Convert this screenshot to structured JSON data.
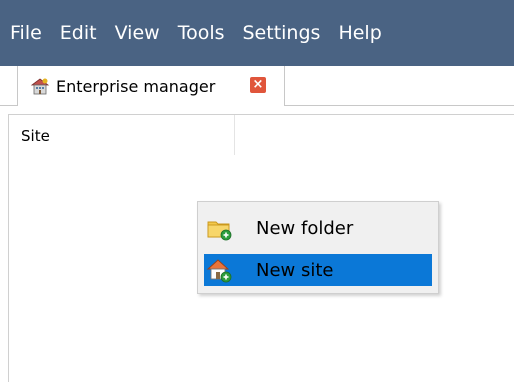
{
  "menubar": {
    "items": [
      "File",
      "Edit",
      "View",
      "Tools",
      "Settings",
      "Help"
    ]
  },
  "tabs": [
    {
      "label": "Enterprise manager",
      "icon": "enterprise-building-icon",
      "close_icon": "close-icon",
      "close_glyph": "×"
    }
  ],
  "panel": {
    "column_header": "Site"
  },
  "context_menu": {
    "items": [
      {
        "label": "New folder",
        "icon": "new-folder-icon",
        "highlighted": false
      },
      {
        "label": "New site",
        "icon": "new-site-icon",
        "highlighted": true
      }
    ]
  },
  "colors": {
    "menubar_bg": "#4a6383",
    "menubar_text": "#ffffff",
    "highlight": "#0b78d7",
    "close_button": "#e0553b",
    "folder_yellow": "#f2c84b",
    "add_green": "#2e9e3e"
  }
}
